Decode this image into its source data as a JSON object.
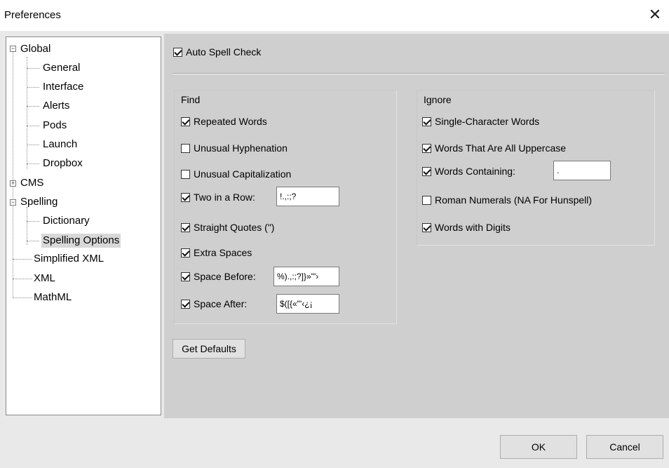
{
  "window": {
    "title": "Preferences",
    "close_glyph": "✕"
  },
  "tree": {
    "items": [
      {
        "label": "Global",
        "toggle": "−"
      },
      {
        "label": "General"
      },
      {
        "label": "Interface"
      },
      {
        "label": "Alerts"
      },
      {
        "label": "Pods"
      },
      {
        "label": "Launch"
      },
      {
        "label": "Dropbox"
      },
      {
        "label": "CMS",
        "toggle": "+"
      },
      {
        "label": "Spelling",
        "toggle": "−"
      },
      {
        "label": "Dictionary"
      },
      {
        "label": "Spelling Options",
        "selected": true
      },
      {
        "label": "Simplified XML"
      },
      {
        "label": "XML"
      },
      {
        "label": "MathML"
      }
    ]
  },
  "auto_spell": {
    "label": "Auto Spell Check",
    "checked": true
  },
  "find": {
    "label": "Find",
    "repeated_words": {
      "label": "Repeated Words",
      "checked": true
    },
    "unusual_hyphenation": {
      "label": "Unusual Hyphenation",
      "checked": false
    },
    "unusual_capitalization": {
      "label": "Unusual Capitalization",
      "checked": false
    },
    "two_in_row": {
      "label": "Two in a Row:",
      "checked": true,
      "value": "!.,:;?"
    },
    "straight_quotes": {
      "label": "Straight Quotes (\")",
      "checked": true
    },
    "extra_spaces": {
      "label": "Extra Spaces",
      "checked": true
    },
    "space_before": {
      "label": "Space Before:",
      "checked": true,
      "value": "%).,:;?]}»\"'›"
    },
    "space_after": {
      "label": "Space After:",
      "checked": true,
      "value": "$([{«\"'‹¿¡"
    }
  },
  "ignore": {
    "label": "Ignore",
    "single_char": {
      "label": "Single-Character Words",
      "checked": true
    },
    "all_uppercase": {
      "label": "Words That Are All Uppercase",
      "checked": true
    },
    "containing": {
      "label": "Words Containing:",
      "checked": true,
      "value": "."
    },
    "roman_numerals": {
      "label": "Roman Numerals (NA For Hunspell)",
      "checked": false
    },
    "with_digits": {
      "label": "Words with Digits",
      "checked": true
    }
  },
  "buttons": {
    "get_defaults": "Get Defaults",
    "ok": "OK",
    "cancel": "Cancel"
  }
}
